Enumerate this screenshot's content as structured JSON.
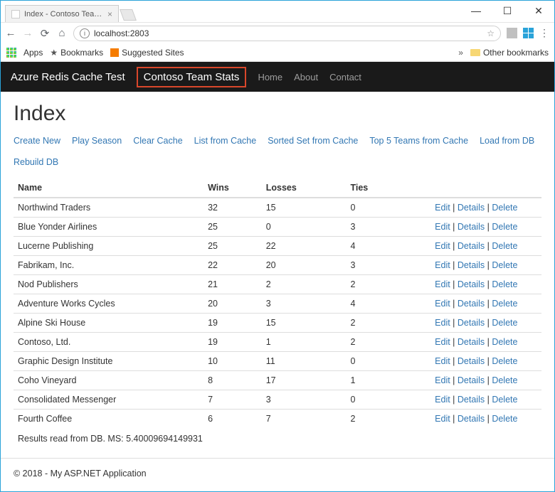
{
  "window": {
    "tab_title": "Index - Contoso Team St",
    "address": "localhost:2803"
  },
  "bookmarks_bar": {
    "apps": "Apps",
    "bookmarks": "Bookmarks",
    "suggested": "Suggested Sites",
    "other": "Other bookmarks"
  },
  "navbar": {
    "brand": "Azure Redis Cache Test",
    "highlight": "Contoso Team Stats",
    "links": [
      "Home",
      "About",
      "Contact"
    ]
  },
  "page": {
    "heading": "Index",
    "actions": [
      "Create New",
      "Play Season",
      "Clear Cache",
      "List from Cache",
      "Sorted Set from Cache",
      "Top 5 Teams from Cache",
      "Load from DB",
      "Rebuild DB"
    ],
    "columns": [
      "Name",
      "Wins",
      "Losses",
      "Ties"
    ],
    "row_actions": [
      "Edit",
      "Details",
      "Delete"
    ],
    "rows": [
      {
        "name": "Northwind Traders",
        "wins": "32",
        "losses": "15",
        "ties": "0"
      },
      {
        "name": "Blue Yonder Airlines",
        "wins": "25",
        "losses": "0",
        "ties": "3"
      },
      {
        "name": "Lucerne Publishing",
        "wins": "25",
        "losses": "22",
        "ties": "4"
      },
      {
        "name": "Fabrikam, Inc.",
        "wins": "22",
        "losses": "20",
        "ties": "3"
      },
      {
        "name": "Nod Publishers",
        "wins": "21",
        "losses": "2",
        "ties": "2"
      },
      {
        "name": "Adventure Works Cycles",
        "wins": "20",
        "losses": "3",
        "ties": "4"
      },
      {
        "name": "Alpine Ski House",
        "wins": "19",
        "losses": "15",
        "ties": "2"
      },
      {
        "name": "Contoso, Ltd.",
        "wins": "19",
        "losses": "1",
        "ties": "2"
      },
      {
        "name": "Graphic Design Institute",
        "wins": "10",
        "losses": "11",
        "ties": "0"
      },
      {
        "name": "Coho Vineyard",
        "wins": "8",
        "losses": "17",
        "ties": "1"
      },
      {
        "name": "Consolidated Messenger",
        "wins": "7",
        "losses": "3",
        "ties": "0"
      },
      {
        "name": "Fourth Coffee",
        "wins": "6",
        "losses": "7",
        "ties": "2"
      }
    ],
    "result_line": "Results read from DB. MS: 5.40009694149931"
  },
  "footer": "© 2018 - My ASP.NET Application"
}
